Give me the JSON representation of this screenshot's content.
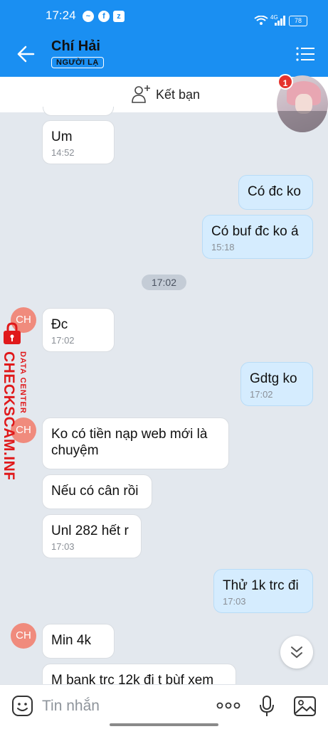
{
  "status_bar": {
    "time": "17:24",
    "network": "4G",
    "battery": "78",
    "app_icons": [
      "messenger-icon",
      "facebook-icon",
      "zalo-icon"
    ]
  },
  "header": {
    "title": "Chí Hải",
    "badge": "NGƯỜI LẠ"
  },
  "add_friend": {
    "label": "Kết bạn"
  },
  "notification_count": "1",
  "messages": [
    {
      "side": "in",
      "text": "Um",
      "time": "14:52"
    },
    {
      "side": "out",
      "text": "Có đc ko",
      "time": ""
    },
    {
      "side": "out",
      "text": "Có buf đc ko á",
      "time": "15:18"
    },
    {
      "side": "in",
      "text": "Đc",
      "time": "17:02",
      "avatar": "CH"
    },
    {
      "side": "out",
      "text": "Gdtg ko",
      "time": "17:02"
    },
    {
      "side": "in",
      "text": "Ko có tiền nạp web mới là chuyệm",
      "time": "",
      "avatar": "CH"
    },
    {
      "side": "in",
      "text": "Nếu có cân rồi",
      "time": ""
    },
    {
      "side": "in",
      "text": "Unl 282 hết r",
      "time": "17:03"
    },
    {
      "side": "out",
      "text": "Thử 1k trc đi",
      "time": "17:03"
    },
    {
      "side": "in",
      "text": "Min 4k",
      "time": "",
      "avatar": "CH"
    },
    {
      "side": "in",
      "text": "M bank trc 12k đi t bùf xem",
      "time": ""
    }
  ],
  "time_divider": "17:02",
  "watermark": {
    "main": "CHECKSCAM.INFO",
    "sub": "DATA CENTER"
  },
  "composer": {
    "placeholder": "Tin nhắn",
    "more": "ooo"
  },
  "colors": {
    "brand": "#1a8ff2",
    "incoming": "#ffffff",
    "outgoing": "#d5ecfe",
    "watermark": "#e0191b",
    "badge": "#e5322d",
    "avatar": "#f08b7d"
  }
}
